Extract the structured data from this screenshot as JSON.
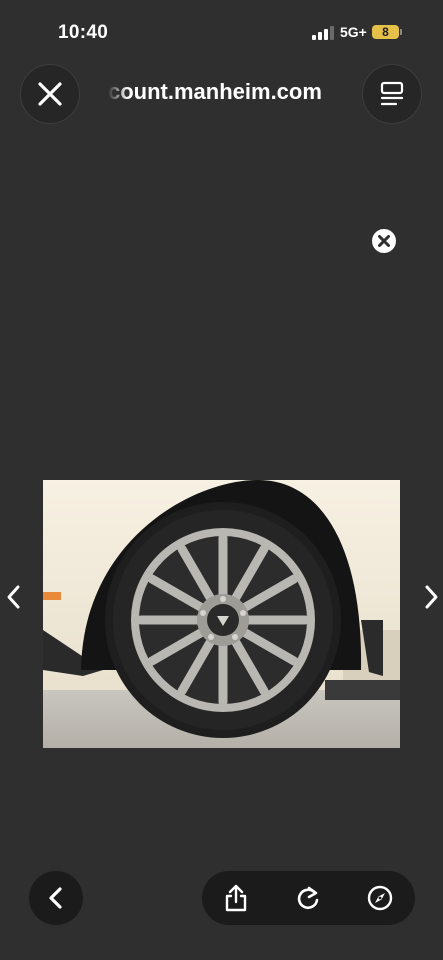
{
  "status_bar": {
    "time": "10:40",
    "network": "5G+",
    "battery": "8",
    "battery_color": "#e5c14a"
  },
  "header": {
    "url": "count.manheim.com",
    "close_icon": "close-icon",
    "reader_icon": "reader-view-icon"
  },
  "viewer": {
    "dismiss_icon": "dismiss-circle-icon",
    "image": "car-wheel-photo",
    "prev_icon": "chevron-left-icon",
    "next_icon": "chevron-right-icon"
  },
  "toolbar": {
    "back_icon": "back-icon",
    "share_icon": "share-icon",
    "reload_icon": "reload-icon",
    "compass_icon": "compass-icon"
  },
  "colors": {
    "background": "#2f2f2f",
    "button_bg": "#1b1b1b",
    "text": "#ffffff"
  }
}
